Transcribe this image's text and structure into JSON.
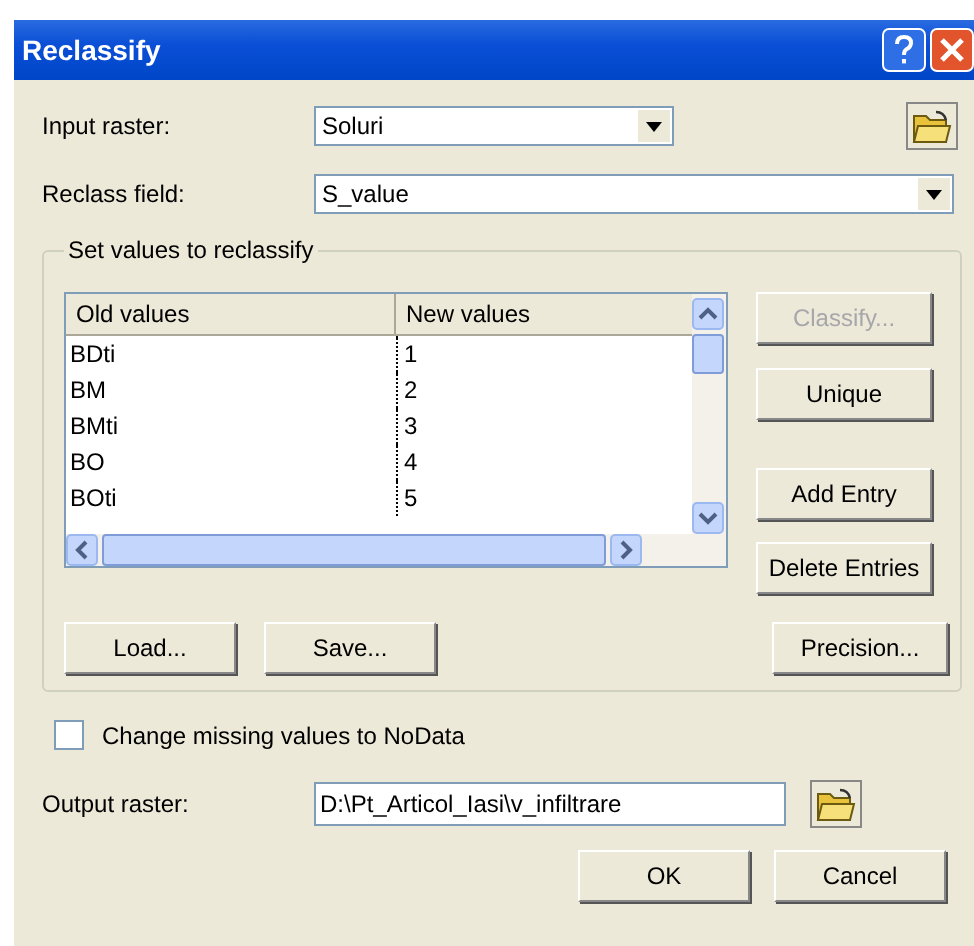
{
  "window": {
    "title": "Reclassify"
  },
  "input_raster": {
    "label": "Input raster:",
    "value": "Soluri"
  },
  "reclass_field": {
    "label": "Reclass field:",
    "value": "S_value"
  },
  "group": {
    "title": "Set values to reclassify",
    "table": {
      "columns": [
        "Old values",
        "New values"
      ],
      "rows": [
        {
          "old": "BDti",
          "new": "1"
        },
        {
          "old": "BM",
          "new": "2"
        },
        {
          "old": "BMti",
          "new": "3"
        },
        {
          "old": "BO",
          "new": "4"
        },
        {
          "old": "BOti",
          "new": "5"
        }
      ]
    },
    "side_buttons": [
      {
        "label": "Classify...",
        "disabled": true
      },
      {
        "label": "Unique",
        "disabled": false
      },
      {
        "label": "Add Entry",
        "disabled": false
      },
      {
        "label": "Delete Entries",
        "disabled": false
      }
    ],
    "bottom_buttons": [
      "Load...",
      "Save...",
      "Precision..."
    ]
  },
  "missing_nodata": {
    "label": "Change missing values to NoData",
    "checked": false
  },
  "output_raster": {
    "label": "Output raster:",
    "value": "D:\\Pt_Articol_Iasi\\v_infiltrare"
  },
  "buttons": [
    "OK",
    "Cancel"
  ]
}
